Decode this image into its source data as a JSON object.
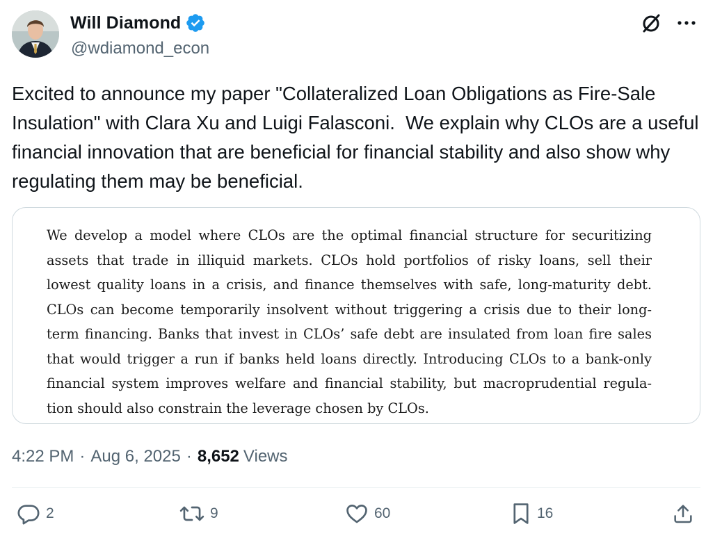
{
  "author": {
    "display_name": "Will Diamond",
    "handle": "@wdiamond_econ",
    "verified": true,
    "verified_color": "#1d9bf0"
  },
  "header_icons": [
    "grok-icon",
    "more-icon"
  ],
  "tweet": {
    "text": "Excited to announce my paper \"Collateralized Loan Obligations as Fire-Sale Insulation\" with Clara Xu and Luigi Falasconi.  We explain why CLOs are a useful financial innovation that are beneficial for financial stability and also show why regulating them may be beneficial."
  },
  "media": {
    "abstract_lines": [
      "We develop a model where CLOs are the optimal financial structure for securitizing",
      "assets that trade in illiquid markets. CLOs hold portfolios of risky loans, sell their",
      "lowest quality loans in a crisis, and finance themselves with safe, long-maturity debt.",
      "CLOs can become temporarily insolvent without triggering a crisis due to their long-",
      "term financing. Banks that invest in CLOs’ safe debt are insulated from loan fire sales",
      "that would trigger a run if banks held loans directly. Introducing CLOs to a bank-only",
      "financial system improves welfare and financial stability, but macroprudential regula-",
      "tion should also constrain the leverage chosen by CLOs."
    ]
  },
  "meta": {
    "time": "4:22 PM",
    "separator": "·",
    "date": "Aug 6, 2025",
    "views_count": "8,652",
    "views_label": "Views"
  },
  "actions": {
    "replies": "2",
    "reposts": "9",
    "likes": "60",
    "bookmarks": "16"
  },
  "colors": {
    "text": "#0f1419",
    "secondary": "#536471",
    "border": "#cfd9de"
  }
}
